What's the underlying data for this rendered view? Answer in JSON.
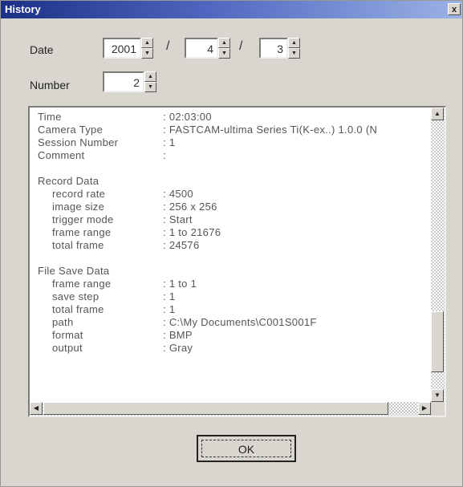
{
  "window": {
    "title": "History",
    "close_glyph": "x"
  },
  "date": {
    "label": "Date",
    "year": "2001",
    "month": "4",
    "day": "3",
    "separator_1": "/",
    "separator_2": "/"
  },
  "number": {
    "label": "Number",
    "value": "2"
  },
  "spin_glyphs": {
    "up": "▲",
    "down": "▼"
  },
  "details": {
    "general": [
      {
        "key": "Time",
        "value": ": 02:03:00"
      },
      {
        "key": "Camera Type",
        "value": ": FASTCAM-ultima Series Ti(K-ex..) 1.0.0 (N"
      },
      {
        "key": "Session Number",
        "value": ": 1"
      },
      {
        "key": "Comment",
        "value": ":"
      }
    ],
    "record_heading": "Record Data",
    "record": [
      {
        "key": "record rate",
        "value": ": 4500"
      },
      {
        "key": "image size",
        "value": ": 256 x 256"
      },
      {
        "key": "trigger mode",
        "value": ": Start"
      },
      {
        "key": "frame range",
        "value": ": 1 to 21676"
      },
      {
        "key": "total frame",
        "value": ": 24576"
      }
    ],
    "file_heading": "File Save Data",
    "file": [
      {
        "key": "frame range",
        "value": ": 1 to 1"
      },
      {
        "key": "save step",
        "value": ": 1"
      },
      {
        "key": "total frame",
        "value": ": 1"
      },
      {
        "key": "path",
        "value": ": C:\\My Documents\\C001S001F"
      },
      {
        "key": "format",
        "value": ": BMP"
      },
      {
        "key": "output",
        "value": ": Gray"
      }
    ]
  },
  "scroll_glyphs": {
    "up": "▲",
    "down": "▼",
    "left": "◀",
    "right": "▶"
  },
  "ok_button": {
    "label": "OK"
  }
}
